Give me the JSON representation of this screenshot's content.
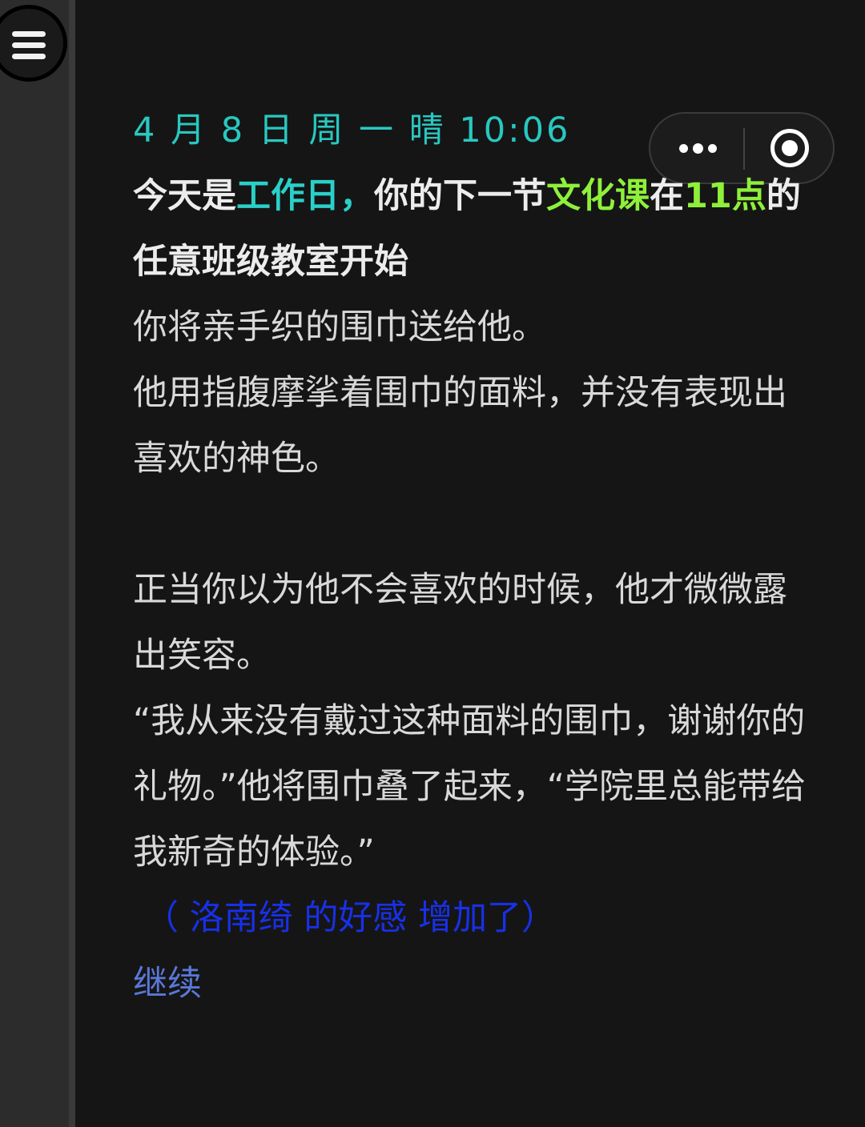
{
  "header": {
    "date_text": "4 月 8 日 周 一 晴 10:06"
  },
  "headline": {
    "prefix": "今天是",
    "day_type": "工作日",
    "comma": "，",
    "middle": "你的下一节",
    "class_name": "文化课",
    "at": "在",
    "time": "11点",
    "suffix": "的任意班级教室开始"
  },
  "story": {
    "p1": "你将亲手织的围巾送给他。",
    "p2": "他用指腹摩挲着围巾的面料，并没有表现出喜欢的神色。",
    "p3": "正当你以为他不会喜欢的时候，他才微微露出笑容。",
    "p4": "“我从来没有戴过这种面料的围巾，谢谢你的礼物。”他将围巾叠了起来，“学院里总能带给我新奇的体验。”"
  },
  "affection_notice": "（ 洛南绮 的好感 增加了）",
  "continue_label": "继续",
  "icons": {
    "menu": "hamburger-menu-icon",
    "more": "more-dots-icon",
    "close": "target-circle-icon"
  },
  "colors": {
    "background": "#151515",
    "date": "#28c8c0",
    "day_type": "#2ad0c8",
    "class_highlight": "#8ef03a",
    "affection": "#1830e8",
    "continue": "#5a78d8"
  }
}
